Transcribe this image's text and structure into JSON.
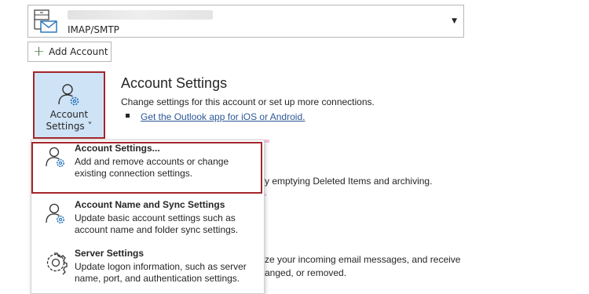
{
  "account_selector": {
    "account_type": "IMAP/SMTP",
    "dropdown_icon": "caret-down-icon",
    "account_icon": "mail-server-icon"
  },
  "add_account": {
    "label": "Add Account",
    "icon": "plus-icon"
  },
  "account_settings_button": {
    "line1": "Account",
    "line2": "Settings ˅",
    "icon": "user-gear-icon"
  },
  "section": {
    "title": "Account Settings",
    "description": "Change settings for this account or set up more connections.",
    "link": "Get the Outlook app for iOS or Android."
  },
  "background_text": {
    "line1": "y emptying Deleted Items and archiving.",
    "line2": "ze your incoming email messages, and receive",
    "line3": "anged, or removed."
  },
  "menu": {
    "items": [
      {
        "title": "Account Settings...",
        "desc": "Add and remove accounts or change existing connection settings.",
        "icon": "user-gear-icon"
      },
      {
        "title": "Account Name and Sync Settings",
        "desc": "Update basic account settings such as account name and folder sync settings.",
        "icon": "user-gear-icon"
      },
      {
        "title": "Server Settings",
        "desc": "Update logon information, such as server name, port, and authentication settings.",
        "icon": "gear-icon"
      }
    ]
  },
  "colors": {
    "highlight_border": "#a4262c",
    "button_selected_bg": "#cfe3f6",
    "link": "#2b5797",
    "pink_hint": "#f3c3e3"
  }
}
